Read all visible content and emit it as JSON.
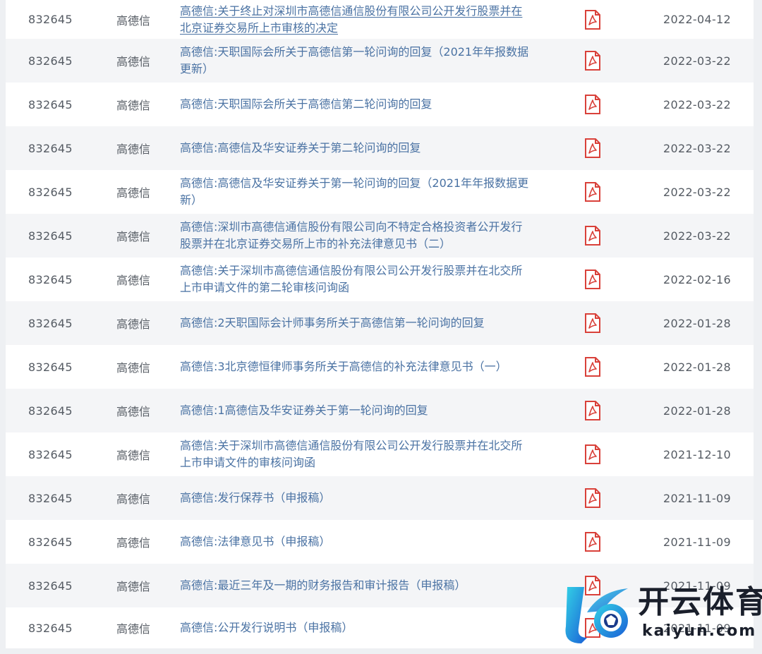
{
  "disclosures": {
    "rows": [
      {
        "code": "832645",
        "name": "高德信",
        "title": "高德信:关于终止对深圳市高德信通信股份有限公司公开发行股票并在北京证券交易所上市审核的决定",
        "title_lines": [
          "高德信:关于终止对深圳市高德信通信股份有限公司公开发行股票并在",
          "北京证券交易所上市审核的决定"
        ],
        "date": "2022-04-12"
      },
      {
        "code": "832645",
        "name": "高德信",
        "title": "高德信:天职国际会所关于高德信第一轮问询的回复（2021年年报数据更新）",
        "title_lines": [
          "高德信:天职国际会所关于高德信第一轮问询的回复（2021年年报数据",
          "更新）"
        ],
        "date": "2022-03-22"
      },
      {
        "code": "832645",
        "name": "高德信",
        "title": "高德信:天职国际会所关于高德信第二轮问询的回复",
        "title_lines": [
          "高德信:天职国际会所关于高德信第二轮问询的回复"
        ],
        "date": "2022-03-22"
      },
      {
        "code": "832645",
        "name": "高德信",
        "title": "高德信:高德信及华安证券关于第二轮问询的回复",
        "title_lines": [
          "高德信:高德信及华安证券关于第二轮问询的回复"
        ],
        "date": "2022-03-22"
      },
      {
        "code": "832645",
        "name": "高德信",
        "title": "高德信:高德信及华安证券关于第一轮问询的回复（2021年年报数据更新）",
        "title_lines": [
          "高德信:高德信及华安证券关于第一轮问询的回复（2021年年报数据更",
          "新）"
        ],
        "date": "2022-03-22"
      },
      {
        "code": "832645",
        "name": "高德信",
        "title": "高德信:深圳市高德信通信股份有限公司向不特定合格投资者公开发行股票并在北京证券交易所上市的补充法律意见书（二）",
        "title_lines": [
          "高德信:深圳市高德信通信股份有限公司向不特定合格投资者公开发行",
          "股票并在北京证券交易所上市的补充法律意见书（二）"
        ],
        "date": "2022-03-22"
      },
      {
        "code": "832645",
        "name": "高德信",
        "title": "高德信:关于深圳市高德信通信股份有限公司公开发行股票并在北交所上市申请文件的第二轮审核问询函",
        "title_lines": [
          "高德信:关于深圳市高德信通信股份有限公司公开发行股票并在北交所",
          "上市申请文件的第二轮审核问询函"
        ],
        "date": "2022-02-16"
      },
      {
        "code": "832645",
        "name": "高德信",
        "title": "高德信:2天职国际会计师事务所关于高德信第一轮问询的回复",
        "title_lines": [
          "高德信:2天职国际会计师事务所关于高德信第一轮问询的回复"
        ],
        "date": "2022-01-28"
      },
      {
        "code": "832645",
        "name": "高德信",
        "title": "高德信:3北京德恒律师事务所关于高德信的补充法律意见书（一）",
        "title_lines": [
          "高德信:3北京德恒律师事务所关于高德信的补充法律意见书（一）"
        ],
        "date": "2022-01-28"
      },
      {
        "code": "832645",
        "name": "高德信",
        "title": "高德信:1高德信及华安证券关于第一轮问询的回复",
        "title_lines": [
          "高德信:1高德信及华安证券关于第一轮问询的回复"
        ],
        "date": "2022-01-28"
      },
      {
        "code": "832645",
        "name": "高德信",
        "title": "高德信:关于深圳市高德信通信股份有限公司公开发行股票并在北交所上市申请文件的审核问询函",
        "title_lines": [
          "高德信:关于深圳市高德信通信股份有限公司公开发行股票并在北交所",
          "上市申请文件的审核问询函"
        ],
        "date": "2021-12-10"
      },
      {
        "code": "832645",
        "name": "高德信",
        "title": "高德信:发行保荐书（申报稿）",
        "title_lines": [
          "高德信:发行保荐书（申报稿）"
        ],
        "date": "2021-11-09"
      },
      {
        "code": "832645",
        "name": "高德信",
        "title": "高德信:法律意见书（申报稿）",
        "title_lines": [
          "高德信:法律意见书（申报稿）"
        ],
        "date": "2021-11-09"
      },
      {
        "code": "832645",
        "name": "高德信",
        "title": "高德信:最近三年及一期的财务报告和审计报告（申报稿）",
        "title_lines": [
          "高德信:最近三年及一期的财务报告和审计报告（申报稿）"
        ],
        "date": "2021-11-09"
      },
      {
        "code": "832645",
        "name": "高德信",
        "title": "高德信:公开发行说明书（申报稿）",
        "title_lines": [
          "高德信:公开发行说明书（申报稿）"
        ],
        "date": "2021-11-09"
      }
    ],
    "pdf_icon": "pdf-file-icon"
  },
  "watermark": {
    "brand_cn": "开云体育",
    "brand_en": "kaiyun.com"
  },
  "colors": {
    "link": "#4a72a3",
    "text": "#555b63",
    "pdf_red": "#d9413a",
    "logo_blue": "#1f8fe0",
    "logo_cyan": "#33d1e6"
  }
}
